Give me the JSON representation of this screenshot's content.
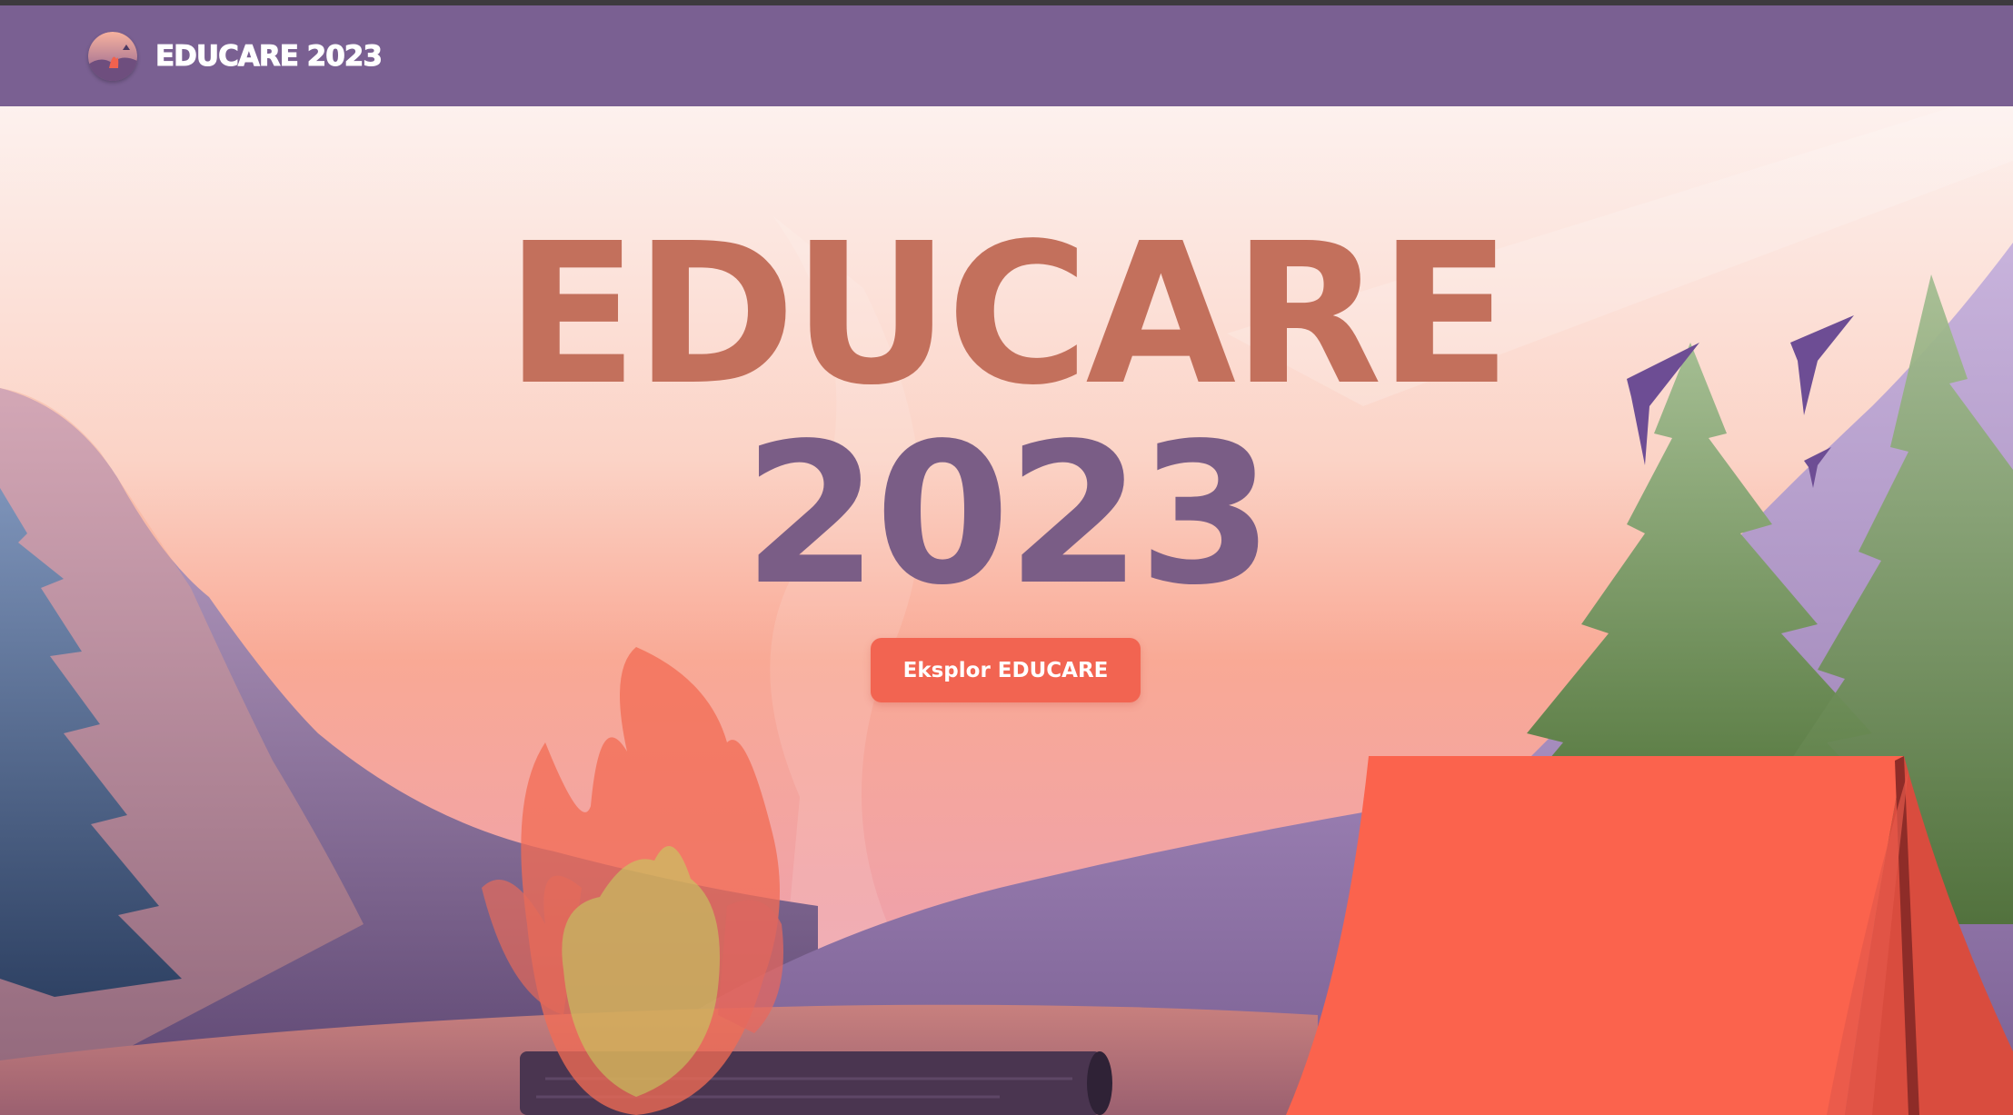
{
  "navbar": {
    "brand_label": "EDUCARE 2023",
    "logo_icon": "campfire-logo-icon"
  },
  "hero": {
    "title_line1": "EDUCARE",
    "title_line2": "2023",
    "cta_label": "Eksplor EDUCARE"
  },
  "colors": {
    "navbar": "#7a6092",
    "cta": "#f26451",
    "title_top": "#c3705c",
    "title_bottom": "#7a5d86",
    "tent": "#fb634d",
    "sky_top": "#fdf1ee",
    "sky_bottom": "#f4a094"
  }
}
